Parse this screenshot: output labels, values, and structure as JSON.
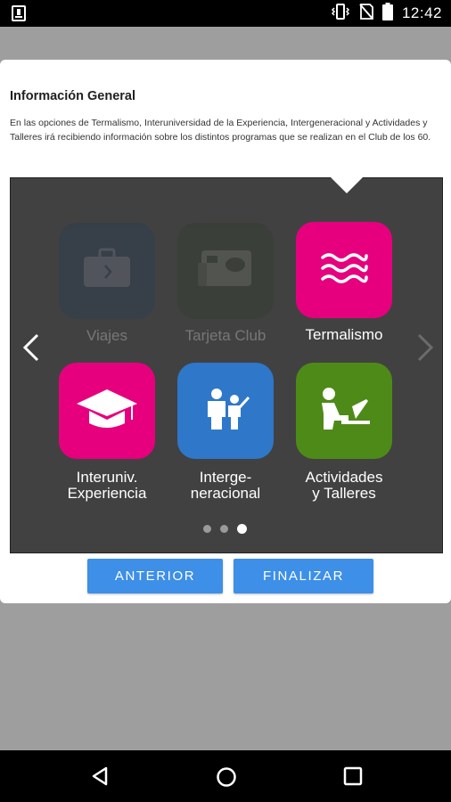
{
  "status_bar": {
    "time": "12:42",
    "icons": [
      "download-notification-icon",
      "vibrate-icon",
      "no-signal-icon",
      "battery-icon"
    ]
  },
  "dialog": {
    "title": "Información General",
    "body": "En las opciones de Termalismo, Interuniversidad de la Experiencia, Intergeneracional y Actividades y Talleres irá recibiendo información sobre los distintos programas que se realizan en el Club de los 60.",
    "tiles": [
      {
        "label": "Viajes",
        "icon": "briefcase-icon",
        "color": "#1e3a5f",
        "faded": true
      },
      {
        "label": "Tarjeta Club",
        "icon": "club-card-icon",
        "color": "#2c3a28",
        "faded": true
      },
      {
        "label": "Termalismo",
        "icon": "waves-icon",
        "color": "#e6007e",
        "faded": false
      },
      {
        "label_line1": "Interuniv.",
        "label_line2": "Experiencia",
        "icon": "graduation-cap-icon",
        "color": "#e6007e"
      },
      {
        "label_line1": "Interge-",
        "label_line2": "neracional",
        "icon": "people-icon",
        "color": "#2f77c9"
      },
      {
        "label_line1": "Actividades",
        "label_line2": "y Talleres",
        "icon": "person-laptop-icon",
        "color": "#4e8a17"
      }
    ],
    "pager": {
      "pages": 3,
      "current": 3
    },
    "buttons": {
      "previous": "ANTERIOR",
      "finish": "FINALIZAR"
    }
  },
  "colors": {
    "accent_button": "#3d8fe8",
    "panel_bg": "#414141",
    "magenta": "#e6007e",
    "blue": "#2f77c9",
    "green": "#4e8a17"
  },
  "nav_bar": {
    "icons": [
      "back-icon",
      "home-icon",
      "recents-icon"
    ]
  }
}
